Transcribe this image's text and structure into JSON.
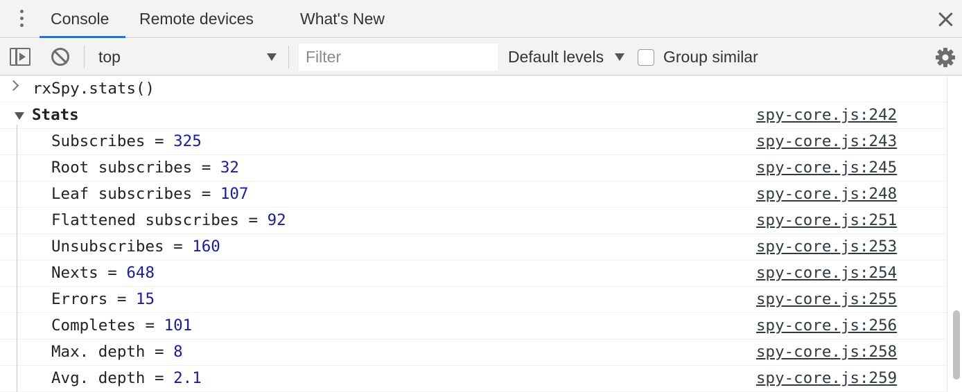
{
  "tabs": [
    {
      "label": "Console",
      "active": true
    },
    {
      "label": "Remote devices",
      "active": false
    },
    {
      "label": "What's New",
      "active": false
    }
  ],
  "toolbar": {
    "context": "top",
    "filter_placeholder": "Filter",
    "levels": "Default levels",
    "group_similar": "Group similar",
    "group_similar_checked": false
  },
  "console": {
    "command": "rxSpy.stats()",
    "group_title": "Stats",
    "group_source": "spy-core.js:242",
    "entries": [
      {
        "label": "Subscribes = ",
        "value": "325",
        "source": "spy-core.js:243"
      },
      {
        "label": "Root subscribes = ",
        "value": "32",
        "source": "spy-core.js:245"
      },
      {
        "label": "Leaf subscribes = ",
        "value": "107",
        "source": "spy-core.js:248"
      },
      {
        "label": "Flattened subscribes = ",
        "value": "92",
        "source": "spy-core.js:251"
      },
      {
        "label": "Unsubscribes = ",
        "value": "160",
        "source": "spy-core.js:253"
      },
      {
        "label": "Nexts = ",
        "value": "648",
        "source": "spy-core.js:254"
      },
      {
        "label": "Errors = ",
        "value": "15",
        "source": "spy-core.js:255"
      },
      {
        "label": "Completes = ",
        "value": "101",
        "source": "spy-core.js:256"
      },
      {
        "label": "Max. depth = ",
        "value": "8",
        "source": "spy-core.js:258"
      },
      {
        "label": "Avg. depth = ",
        "value": "2.1",
        "source": "spy-core.js:259"
      }
    ]
  },
  "colors": {
    "accent": "#1a73e8",
    "number": "#1a1aa6"
  }
}
